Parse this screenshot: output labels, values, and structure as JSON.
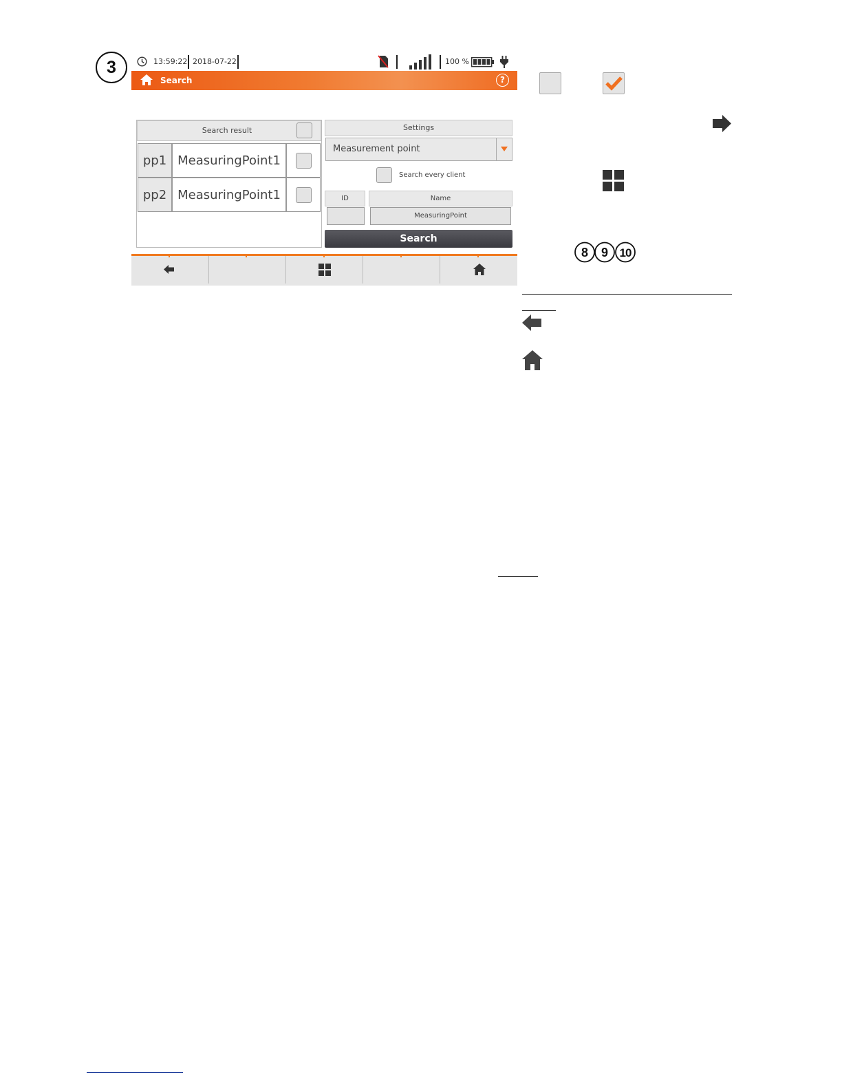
{
  "step_marker": "3",
  "device": {
    "status": {
      "time": "13:59:22",
      "date": "2018-07-22",
      "battery_percent": "100 %"
    },
    "title": "Search",
    "search_result": {
      "header": "Search result",
      "rows": [
        {
          "id": "pp1",
          "name": "MeasuringPoint1"
        },
        {
          "id": "pp2",
          "name": "MeasuringPoint1"
        }
      ]
    },
    "settings": {
      "header": "Settings",
      "object_type": "Measurement point",
      "search_every_client": "Search every client",
      "id_label": "ID",
      "name_label": "Name",
      "id_value": "",
      "name_value": "MeasuringPoint",
      "search_button": "Search"
    },
    "bottom_bar": [
      "back-icon",
      "",
      "menu-grid-icon",
      "",
      "home-icon"
    ]
  },
  "side_icons": {
    "markers": [
      "8",
      "9",
      "10"
    ]
  },
  "colors": {
    "accent": "#f07a20",
    "title_bar": "#ec5a14",
    "button_dark": "#45454b"
  }
}
